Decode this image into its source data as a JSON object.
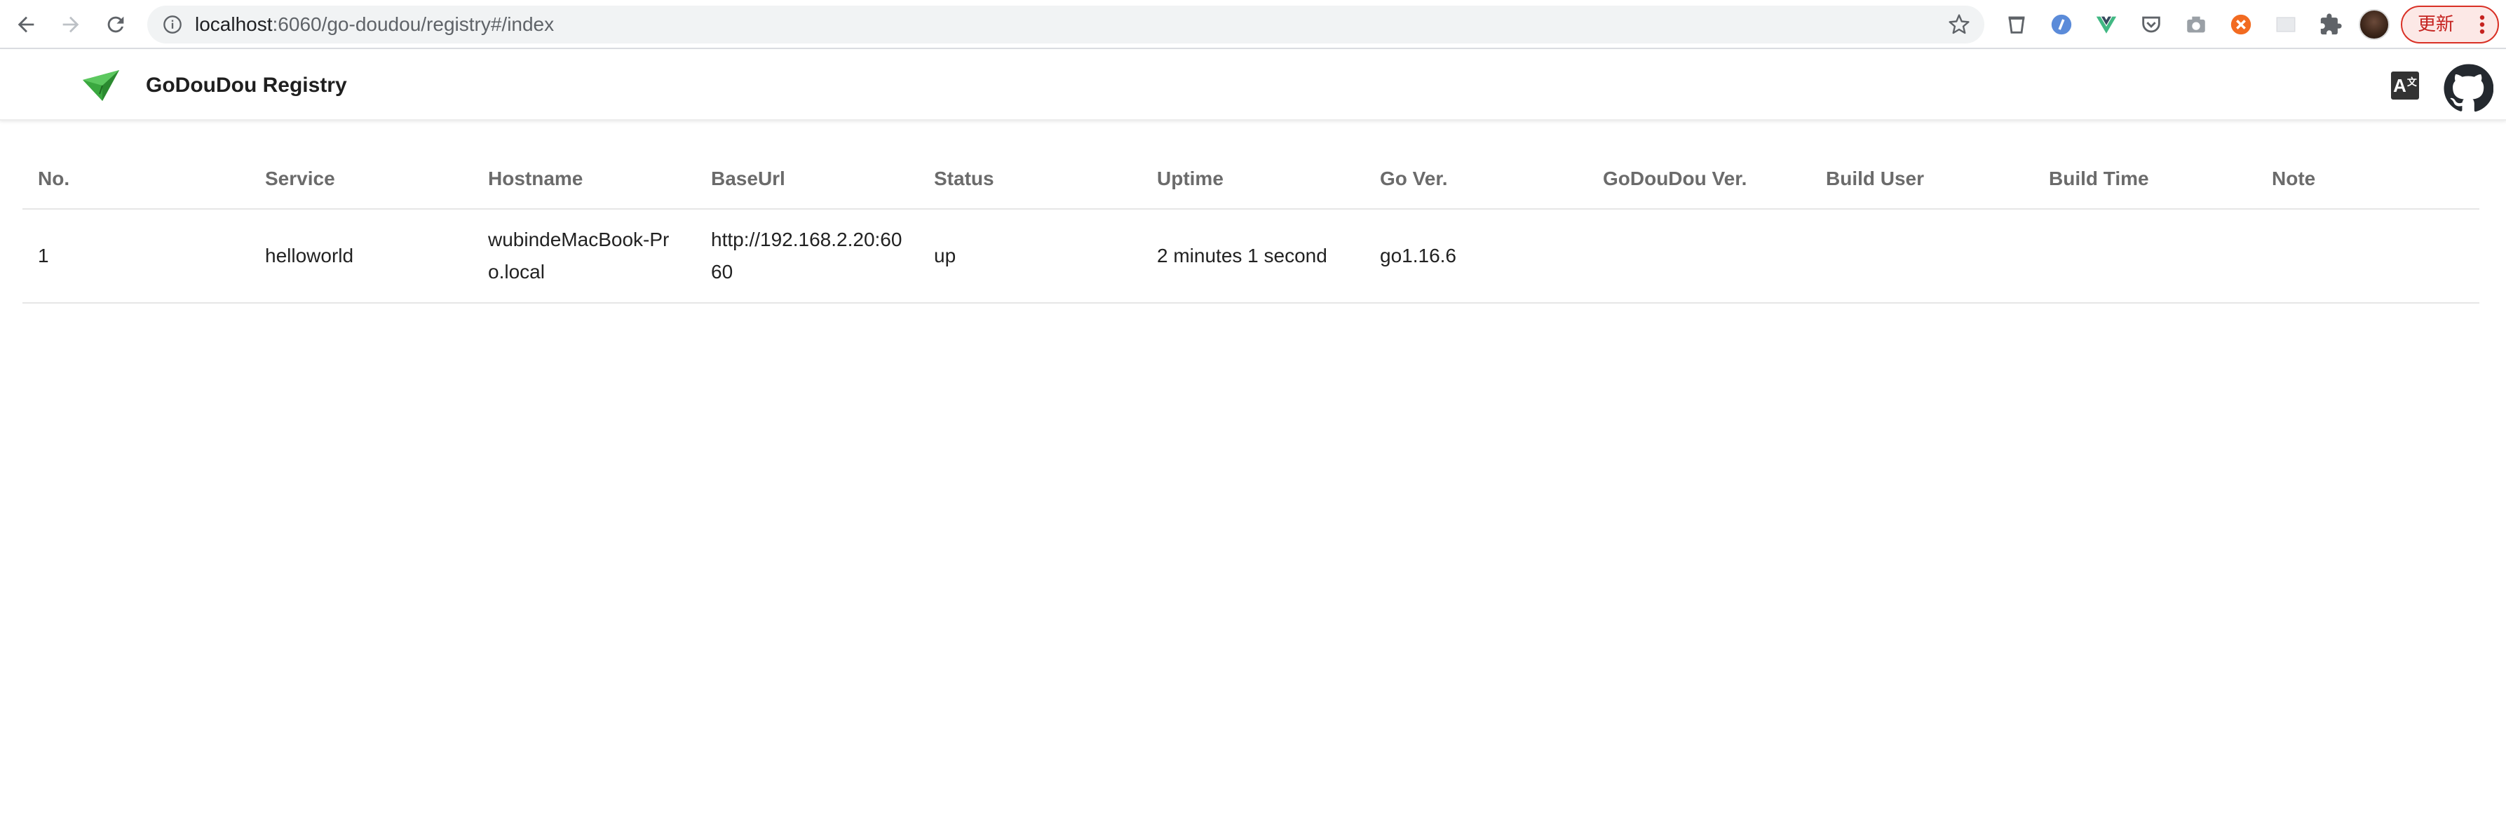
{
  "browser": {
    "url_host": "localhost",
    "url_path": ":6060/go-doudou/registry#/index",
    "update_label": "更新"
  },
  "app": {
    "title": "GoDouDou Registry",
    "lang_label": "A"
  },
  "table": {
    "headers": [
      "No.",
      "Service",
      "Hostname",
      "BaseUrl",
      "Status",
      "Uptime",
      "Go Ver.",
      "GoDouDou Ver.",
      "Build User",
      "Build Time",
      "Note"
    ],
    "rows": [
      {
        "no": "1",
        "service": "helloworld",
        "hostname": "wubindeMacBook-Pro.local",
        "baseurl": "http://192.168.2.20:6060",
        "status": "up",
        "uptime": "2 minutes 1 second",
        "go_ver": "go1.16.6",
        "godoudou_ver": "",
        "build_user": "",
        "build_time": "",
        "note": ""
      }
    ]
  },
  "colors": {
    "brand_green": "#3aa83f",
    "update_red": "#d93025"
  }
}
